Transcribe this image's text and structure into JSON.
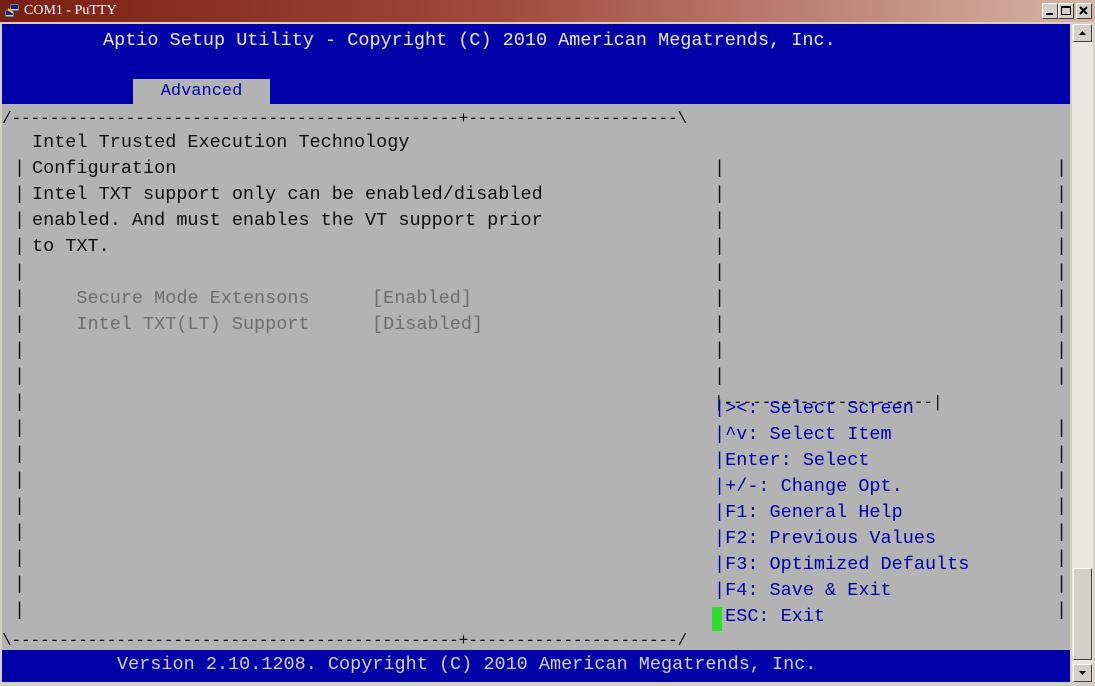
{
  "window": {
    "title": "COM1 - PuTTY",
    "icon": "putty-icon",
    "buttons": [
      "minimize",
      "maximize",
      "close"
    ]
  },
  "bios": {
    "header_title": "Aptio Setup Utility - Copyright (C) 2010 American Megatrends, Inc.",
    "active_tab": "Advanced",
    "top_border_left": "/-----------------------------------------------+----------------------\\",
    "middle_border_right": "|----------------------|",
    "bottom_border": "\\-----------------------------------------------+----------------------/",
    "left_lines": [
      "Intel Trusted Execution Technology",
      "Configuration",
      "Intel TXT support only can be enabled/disabled",
      "enabled. And must enables the VT support prior",
      "to TXT."
    ],
    "settings": [
      {
        "label": "Secure Mode Extensons",
        "value": "[Enabled]"
      },
      {
        "label": "Intel TXT(LT) Support",
        "value": "[Disabled]"
      }
    ],
    "help_keys": [
      "><: Select Screen",
      "^v: Select Item",
      "Enter: Select",
      "+/-: Change Opt.",
      "F1: General Help",
      "F2: Previous Values",
      "F3: Optimized Defaults",
      "F4: Save & Exit",
      "ESC: Exit"
    ],
    "footer": "Version 2.10.1208. Copyright (C) 2010 American Megatrends, Inc."
  },
  "colors": {
    "header_blue": "#0000a8",
    "body_grey": "#b3b3b3",
    "cursor_green": "#2bde2b",
    "titlebar": "#7a1e14"
  }
}
